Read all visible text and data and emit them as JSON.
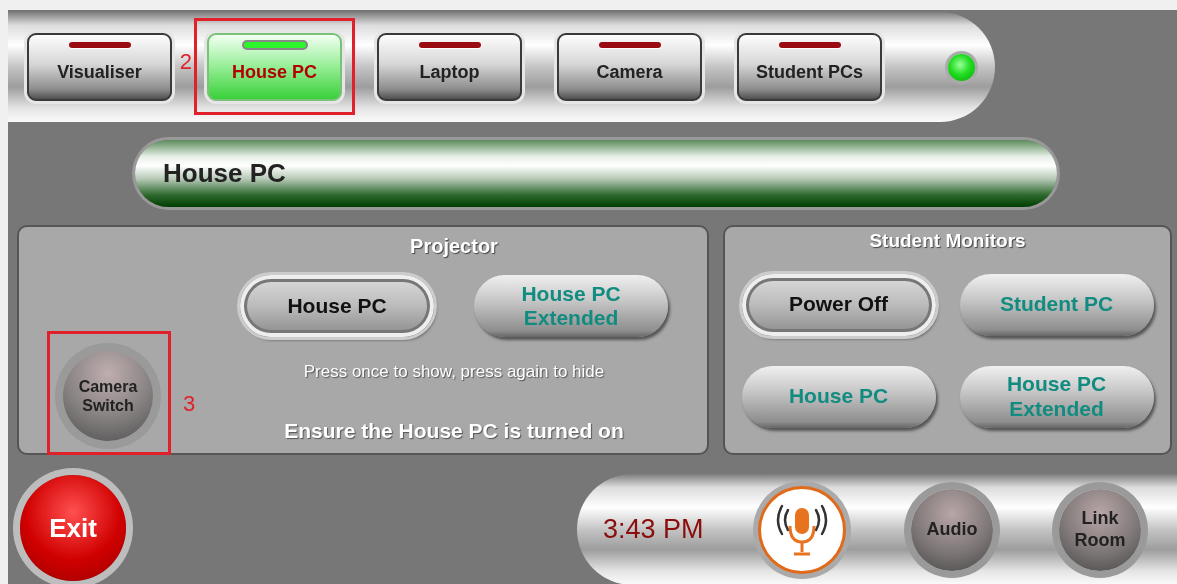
{
  "source_tabs": [
    {
      "label": "Visualiser",
      "selected": false
    },
    {
      "label": "House PC",
      "selected": true,
      "annotation": "2"
    },
    {
      "label": "Laptop",
      "selected": false
    },
    {
      "label": "Camera",
      "selected": false
    },
    {
      "label": "Student PCs",
      "selected": false
    }
  ],
  "status_led": {
    "on": true
  },
  "title_bar": {
    "text": "House PC"
  },
  "projector": {
    "title": "Projector",
    "buttons": [
      {
        "label": "House PC",
        "selected": true
      },
      {
        "label": "House PC Extended",
        "selected": false
      }
    ],
    "hint": "Press once to show, press again to hide",
    "notice": "Ensure the House PC is turned on",
    "camera_switch": {
      "label": "Camera Switch",
      "annotation": "3"
    }
  },
  "student_monitors": {
    "title": "Student Monitors",
    "buttons": [
      {
        "label": "Power Off",
        "selected": true
      },
      {
        "label": "Student PC",
        "selected": false
      },
      {
        "label": "House PC",
        "selected": false
      },
      {
        "label": "House PC Extended",
        "selected": false
      }
    ]
  },
  "exit": {
    "label": "Exit"
  },
  "bottom_bar": {
    "time": "3:43 PM",
    "audio": "Audio",
    "link_room": "Link Room"
  }
}
